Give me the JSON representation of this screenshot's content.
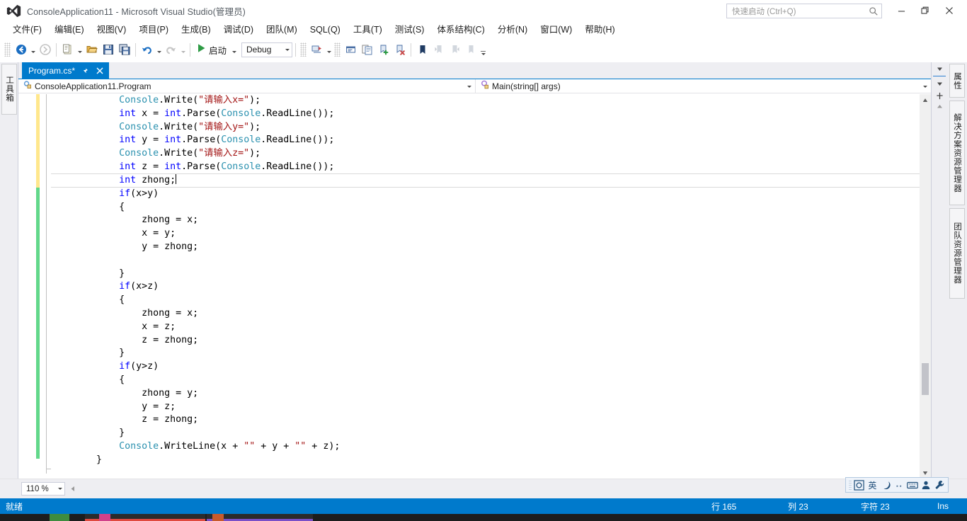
{
  "window": {
    "title": "ConsoleApplication11 - Microsoft Visual Studio(管理员)",
    "logo_icon": "visual-studio-logo-icon",
    "minimize_label": "—",
    "maximize_label": "❐",
    "close_label": "✕"
  },
  "quick_launch": {
    "placeholder": "快速启动 (Ctrl+Q)",
    "icon": "search-icon"
  },
  "menubar": {
    "items": [
      {
        "label": "文件(F)",
        "name": "menu-file"
      },
      {
        "label": "编辑(E)",
        "name": "menu-edit"
      },
      {
        "label": "视图(V)",
        "name": "menu-view"
      },
      {
        "label": "项目(P)",
        "name": "menu-project"
      },
      {
        "label": "生成(B)",
        "name": "menu-build"
      },
      {
        "label": "调试(D)",
        "name": "menu-debug"
      },
      {
        "label": "团队(M)",
        "name": "menu-team"
      },
      {
        "label": "SQL(Q)",
        "name": "menu-sql"
      },
      {
        "label": "工具(T)",
        "name": "menu-tools"
      },
      {
        "label": "测试(S)",
        "name": "menu-test"
      },
      {
        "label": "体系结构(C)",
        "name": "menu-architecture"
      },
      {
        "label": "分析(N)",
        "name": "menu-analyze"
      },
      {
        "label": "窗口(W)",
        "name": "menu-window"
      },
      {
        "label": "帮助(H)",
        "name": "menu-help"
      }
    ]
  },
  "toolbar": {
    "start_label": "启动",
    "configuration": "Debug",
    "buttons": [
      "navigate-backward-icon",
      "navigate-forward-icon",
      "new-project-icon",
      "open-file-icon",
      "save-icon",
      "save-all-icon",
      "undo-icon",
      "redo-icon",
      "start-debug-icon",
      "solution-platforms-icon",
      "find-in-files-icon",
      "comment-icon",
      "add-bookmark-icon",
      "remove-bookmark-icon",
      "toggle-bookmark-icon",
      "previous-bookmark-icon",
      "next-bookmark-icon",
      "clear-bookmarks-icon",
      "toolbar-options-icon"
    ]
  },
  "left_dock": {
    "tab_label": "工具箱",
    "tab_name": "vertical-tab-toolbox"
  },
  "right_dock": {
    "tabs": [
      {
        "label": "属性",
        "name": "vertical-tab-properties"
      },
      {
        "label": "解决方案资源管理器",
        "name": "vertical-tab-solution-explorer"
      },
      {
        "label": "团队资源管理器",
        "name": "vertical-tab-team-explorer"
      }
    ]
  },
  "document_tab": {
    "name": "Program.cs*",
    "pin_icon": "pin-icon",
    "close_icon": "close-icon"
  },
  "navbar": {
    "type_dropdown": "ConsoleApplication11.Program",
    "type_icon": "class-icon",
    "member_dropdown": "Main(string[] args)",
    "member_icon": "method-icon"
  },
  "editor": {
    "zoom": "110 %",
    "current_line_index": 6,
    "lines": [
      {
        "indent": 12,
        "tokens": [
          {
            "t": "Console",
            "c": "typ"
          },
          {
            "t": ".Write(",
            "c": "pln"
          },
          {
            "t": "\"请输入x=\"",
            "c": "str"
          },
          {
            "t": ");",
            "c": "pln"
          }
        ]
      },
      {
        "indent": 12,
        "tokens": [
          {
            "t": "int",
            "c": "kw"
          },
          {
            "t": " x = ",
            "c": "pln"
          },
          {
            "t": "int",
            "c": "kw"
          },
          {
            "t": ".Parse(",
            "c": "pln"
          },
          {
            "t": "Console",
            "c": "typ"
          },
          {
            "t": ".ReadLine());",
            "c": "pln"
          }
        ]
      },
      {
        "indent": 12,
        "tokens": [
          {
            "t": "Console",
            "c": "typ"
          },
          {
            "t": ".Write(",
            "c": "pln"
          },
          {
            "t": "\"请输入y=\"",
            "c": "str"
          },
          {
            "t": ");",
            "c": "pln"
          }
        ]
      },
      {
        "indent": 12,
        "tokens": [
          {
            "t": "int",
            "c": "kw"
          },
          {
            "t": " y = ",
            "c": "pln"
          },
          {
            "t": "int",
            "c": "kw"
          },
          {
            "t": ".Parse(",
            "c": "pln"
          },
          {
            "t": "Console",
            "c": "typ"
          },
          {
            "t": ".ReadLine());",
            "c": "pln"
          }
        ]
      },
      {
        "indent": 12,
        "tokens": [
          {
            "t": "Console",
            "c": "typ"
          },
          {
            "t": ".Write(",
            "c": "pln"
          },
          {
            "t": "\"请输入z=\"",
            "c": "str"
          },
          {
            "t": ");",
            "c": "pln"
          }
        ]
      },
      {
        "indent": 12,
        "tokens": [
          {
            "t": "int",
            "c": "kw"
          },
          {
            "t": " z = ",
            "c": "pln"
          },
          {
            "t": "int",
            "c": "kw"
          },
          {
            "t": ".Parse(",
            "c": "pln"
          },
          {
            "t": "Console",
            "c": "typ"
          },
          {
            "t": ".ReadLine());",
            "c": "pln"
          }
        ]
      },
      {
        "indent": 12,
        "caret": true,
        "tokens": [
          {
            "t": "int",
            "c": "kw"
          },
          {
            "t": " zhong;",
            "c": "pln"
          }
        ]
      },
      {
        "indent": 12,
        "tokens": [
          {
            "t": "if",
            "c": "kw"
          },
          {
            "t": "(x>y)",
            "c": "pln"
          }
        ]
      },
      {
        "indent": 12,
        "tokens": [
          {
            "t": "{",
            "c": "pln"
          }
        ]
      },
      {
        "indent": 16,
        "tokens": [
          {
            "t": "zhong = x;",
            "c": "pln"
          }
        ]
      },
      {
        "indent": 16,
        "tokens": [
          {
            "t": "x = y;",
            "c": "pln"
          }
        ]
      },
      {
        "indent": 16,
        "tokens": [
          {
            "t": "y = zhong;",
            "c": "pln"
          }
        ]
      },
      {
        "indent": 0,
        "tokens": [
          {
            "t": "",
            "c": "pln"
          }
        ]
      },
      {
        "indent": 12,
        "tokens": [
          {
            "t": "}",
            "c": "pln"
          }
        ]
      },
      {
        "indent": 12,
        "tokens": [
          {
            "t": "if",
            "c": "kw"
          },
          {
            "t": "(x>z)",
            "c": "pln"
          }
        ]
      },
      {
        "indent": 12,
        "tokens": [
          {
            "t": "{",
            "c": "pln"
          }
        ]
      },
      {
        "indent": 16,
        "tokens": [
          {
            "t": "zhong = x;",
            "c": "pln"
          }
        ]
      },
      {
        "indent": 16,
        "tokens": [
          {
            "t": "x = z;",
            "c": "pln"
          }
        ]
      },
      {
        "indent": 16,
        "tokens": [
          {
            "t": "z = zhong;",
            "c": "pln"
          }
        ]
      },
      {
        "indent": 12,
        "tokens": [
          {
            "t": "}",
            "c": "pln"
          }
        ]
      },
      {
        "indent": 12,
        "tokens": [
          {
            "t": "if",
            "c": "kw"
          },
          {
            "t": "(y>z)",
            "c": "pln"
          }
        ]
      },
      {
        "indent": 12,
        "tokens": [
          {
            "t": "{",
            "c": "pln"
          }
        ]
      },
      {
        "indent": 16,
        "tokens": [
          {
            "t": "zhong = y;",
            "c": "pln"
          }
        ]
      },
      {
        "indent": 16,
        "tokens": [
          {
            "t": "y = z;",
            "c": "pln"
          }
        ]
      },
      {
        "indent": 16,
        "tokens": [
          {
            "t": "z = zhong;",
            "c": "pln"
          }
        ]
      },
      {
        "indent": 12,
        "tokens": [
          {
            "t": "}",
            "c": "pln"
          }
        ]
      },
      {
        "indent": 12,
        "tokens": [
          {
            "t": "Console",
            "c": "typ"
          },
          {
            "t": ".WriteLine(x + ",
            "c": "pln"
          },
          {
            "t": "\"\"",
            "c": "str"
          },
          {
            "t": " + y + ",
            "c": "pln"
          },
          {
            "t": "\"\"",
            "c": "str"
          },
          {
            "t": " + z);",
            "c": "pln"
          }
        ]
      },
      {
        "indent": 8,
        "tokens": [
          {
            "t": "}",
            "c": "pln"
          }
        ]
      }
    ]
  },
  "ime_bar": {
    "icons": [
      "ime-mode-icon",
      "chinese-english-toggle-icon",
      "half-full-width-icon",
      "punctuation-icon",
      "soft-keyboard-icon",
      "user-dictionary-icon",
      "ime-settings-icon"
    ],
    "lang_label": "英"
  },
  "statusbar": {
    "ready": "就绪",
    "line_label": "行 165",
    "column_label": "列 23",
    "char_label": "字符 23",
    "insert_mode": "Ins"
  },
  "colors": {
    "accent": "#007acc",
    "titlebar_bg": "#ffffff",
    "chrome_bg": "#eeeef2",
    "keyword": "#0000ff",
    "type": "#2b91af",
    "string": "#a31515",
    "change_unsaved": "#ffe78c",
    "change_saved": "#62d88a"
  }
}
